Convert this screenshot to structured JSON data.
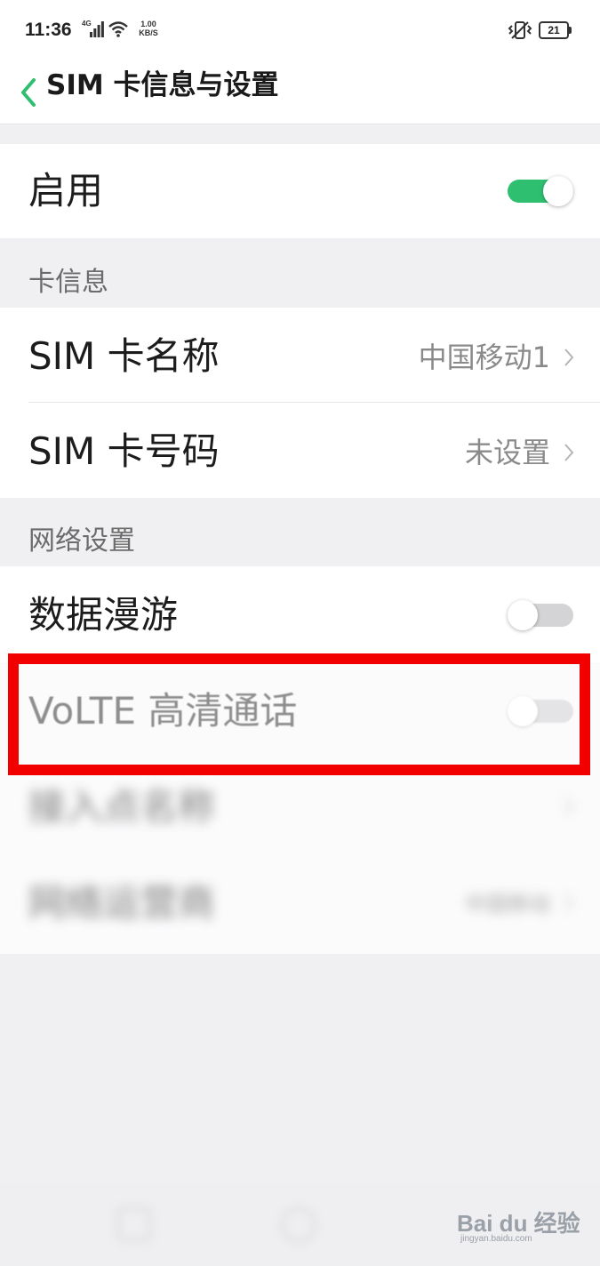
{
  "status_bar": {
    "time": "11:36",
    "network_type": "4G",
    "speed_value": "1.00",
    "speed_unit": "KB/S",
    "battery_level": "21"
  },
  "header": {
    "title": "SIM 卡信息与设置",
    "back_icon": "chevron-left-icon"
  },
  "enable_row": {
    "label": "启用",
    "toggle_state": "on"
  },
  "card_info": {
    "section_title": "卡信息",
    "items": [
      {
        "label": "SIM 卡名称",
        "value": "中国移动1"
      },
      {
        "label": "SIM 卡号码",
        "value": "未设置"
      }
    ]
  },
  "network_settings": {
    "section_title": "网络设置",
    "data_roaming": {
      "label": "数据漫游",
      "toggle_state": "off"
    },
    "volte": {
      "label": "VoLTE 高清通话",
      "toggle_state": "off",
      "enabled": false
    },
    "apn": {
      "label": "接入点名称"
    },
    "operator": {
      "label": "网络运营商",
      "value": "中国移动"
    }
  },
  "watermark": {
    "brand": "Bai du 经验",
    "sub": "jingyan.baidu.com"
  },
  "colors": {
    "accent_green": "#2fbf71",
    "highlight_red": "#f20000"
  }
}
